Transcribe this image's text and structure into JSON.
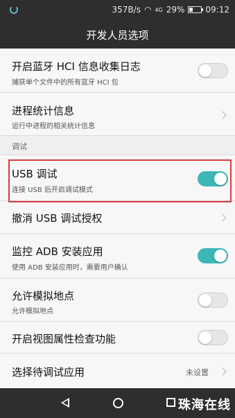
{
  "status_bar": {
    "network_speed": "357B/s",
    "signal": "4G",
    "battery": "29%",
    "time": "09:12"
  },
  "title": "开发人员选项",
  "items": [
    {
      "title": "开启蓝牙 HCI 信息收集日志",
      "subtitle": "捕获单个文件中的所有蓝牙 HCI 包",
      "toggle": false
    },
    {
      "title": "进程统计信息",
      "subtitle": "运行中进程的相关统计信息"
    },
    {
      "title": "USB 调试",
      "subtitle": "连接 USB 后开启调试模式",
      "toggle": true
    },
    {
      "title": "撤消 USB 调试授权"
    },
    {
      "title": "监控 ADB 安装应用",
      "subtitle": "使用 ADB 安装应用时，需要用户确认",
      "toggle": true
    },
    {
      "title": "允许模拟地点",
      "subtitle": "允许模拟地点",
      "toggle": false
    },
    {
      "title": "开启视图属性检查功能",
      "toggle": false
    },
    {
      "title": "选择待调试应用",
      "value": "未设置"
    }
  ],
  "section": "调试",
  "watermark": "珠海在线",
  "colors": {
    "toggle_on": "#3cb6b7",
    "highlight": "#d93a3a",
    "bar": "#2e2e2e"
  }
}
